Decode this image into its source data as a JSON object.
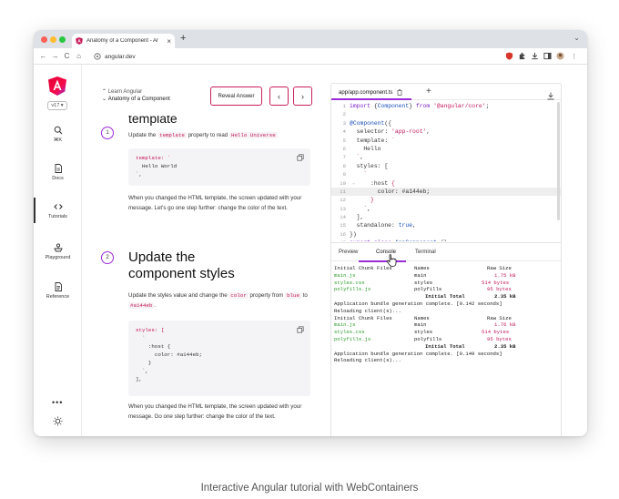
{
  "browser": {
    "tab_title": "Anatomy of a Component - Ar",
    "tab_close": "×",
    "new_tab": "+",
    "tab_menu": "⌄",
    "url": "angular.dev",
    "nav": {
      "back": "←",
      "forward": "→",
      "reload": "C",
      "home": "⌂"
    },
    "extensions": [
      "shield-icon",
      "puzzle-icon",
      "download-icon",
      "sidebar-icon",
      "profile-icon",
      "menu-icon"
    ],
    "menu_dots": "⋮",
    "traffic_lights": [
      "#ff5f57",
      "#febc2e",
      "#28c840"
    ]
  },
  "sidebar": {
    "version": "v17 ▾",
    "items": [
      {
        "label": "⌘K",
        "icon": "search-icon"
      },
      {
        "label": "Docs",
        "icon": "docs-icon"
      },
      {
        "label": "Tutorials",
        "icon": "code-icon"
      },
      {
        "label": "Playground",
        "icon": "playground-icon"
      },
      {
        "label": "Reference",
        "icon": "reference-icon"
      }
    ],
    "more": "•••"
  },
  "lesson": {
    "breadcrumb_parent": "Learn Angular",
    "breadcrumb_title": "Anatomy of a Component",
    "reveal_label": "Reveal Answer",
    "prev_label": "‹",
    "next_label": "›",
    "partial_heading": "template",
    "step1_number": "1",
    "step1_parts": [
      "Update the ",
      "template",
      " property to read ",
      "Hello Universe"
    ],
    "code1_lines": [
      "template: `",
      "  Hello World",
      "`,"
    ],
    "para1": "When you changed the HTML template, the screen updated with your message. Let's go one step further: change the color of the text.",
    "step2_number": "2",
    "step2_heading_line1": "Update the",
    "step2_heading_line2": "component styles",
    "step2_parts": [
      "Update the styles value and change the ",
      "color",
      " property from ",
      "blue",
      " to ",
      "#a144eb",
      "."
    ],
    "code2_lines": [
      "styles: [",
      "  `",
      "    :host {",
      "      color: #a144eb;",
      "    }",
      "  `,",
      "],"
    ],
    "para2": "When you changed the HTML template, the screen updated with your message. Go one step further: change the color of the text."
  },
  "editor": {
    "file_tab": "app/app.component.ts",
    "add_tab": "+",
    "code_lines": [
      {
        "n": "1",
        "t": "import {Component} from '@angular/core';"
      },
      {
        "n": "2",
        "t": ""
      },
      {
        "n": "3",
        "t": "@Component({"
      },
      {
        "n": "4",
        "t": "  selector: 'app-root',"
      },
      {
        "n": "5",
        "t": "  template: `"
      },
      {
        "n": "6",
        "t": "    Hello"
      },
      {
        "n": "7",
        "t": "  `,"
      },
      {
        "n": "8",
        "t": "  styles: ["
      },
      {
        "n": "9",
        "t": "    `"
      },
      {
        "n": "10",
        "t": "      :host {"
      },
      {
        "n": "11",
        "t": "        color: #a144eb;"
      },
      {
        "n": "12",
        "t": "      }"
      },
      {
        "n": "13",
        "t": "    `,"
      },
      {
        "n": "14",
        "t": "  ],"
      },
      {
        "n": "15",
        "t": "  standalone: true,"
      },
      {
        "n": "16",
        "t": "})"
      },
      {
        "n": "17",
        "t": "export class AppComponent {}"
      }
    ],
    "output_tabs": [
      "Preview",
      "Console",
      "Terminal"
    ],
    "active_output_tab": "Console",
    "console_rows": [
      [
        "Initial Chunk Files",
        "Names",
        "Raw Size",
        ""
      ],
      [
        "main.js",
        "main",
        "1.75 kB",
        ""
      ],
      [
        "styles.css",
        "styles",
        "514 bytes",
        ""
      ],
      [
        "polyfills.js",
        "polyfills",
        "95 bytes",
        ""
      ],
      [
        "",
        "Initial Total",
        "2.35 kB",
        ""
      ],
      [
        "Application bundle generation complete. [0.142 seconds]",
        "",
        "",
        ""
      ],
      [
        "Reloading client(s)...",
        "",
        "",
        ""
      ],
      [
        "Initial Chunk Files",
        "Names",
        "Raw Size",
        ""
      ],
      [
        "main.js",
        "main",
        "1.76 kB",
        ""
      ],
      [
        "styles.css",
        "styles",
        "514 bytes",
        ""
      ],
      [
        "polyfills.js",
        "polyfills",
        "95 bytes",
        ""
      ],
      [
        "",
        "Initial Total",
        "2.35 kB",
        ""
      ],
      [
        "Application bundle generation complete. [0.149 seconds]",
        "",
        "",
        ""
      ],
      [
        "Reloading client(s)...",
        "",
        "",
        ""
      ]
    ]
  },
  "caption": "Interactive Angular tutorial with WebContainers",
  "colors": {
    "accent": "#9a2bd8",
    "brand_pink": "#c81e5b",
    "green": "#2f9b2f"
  }
}
